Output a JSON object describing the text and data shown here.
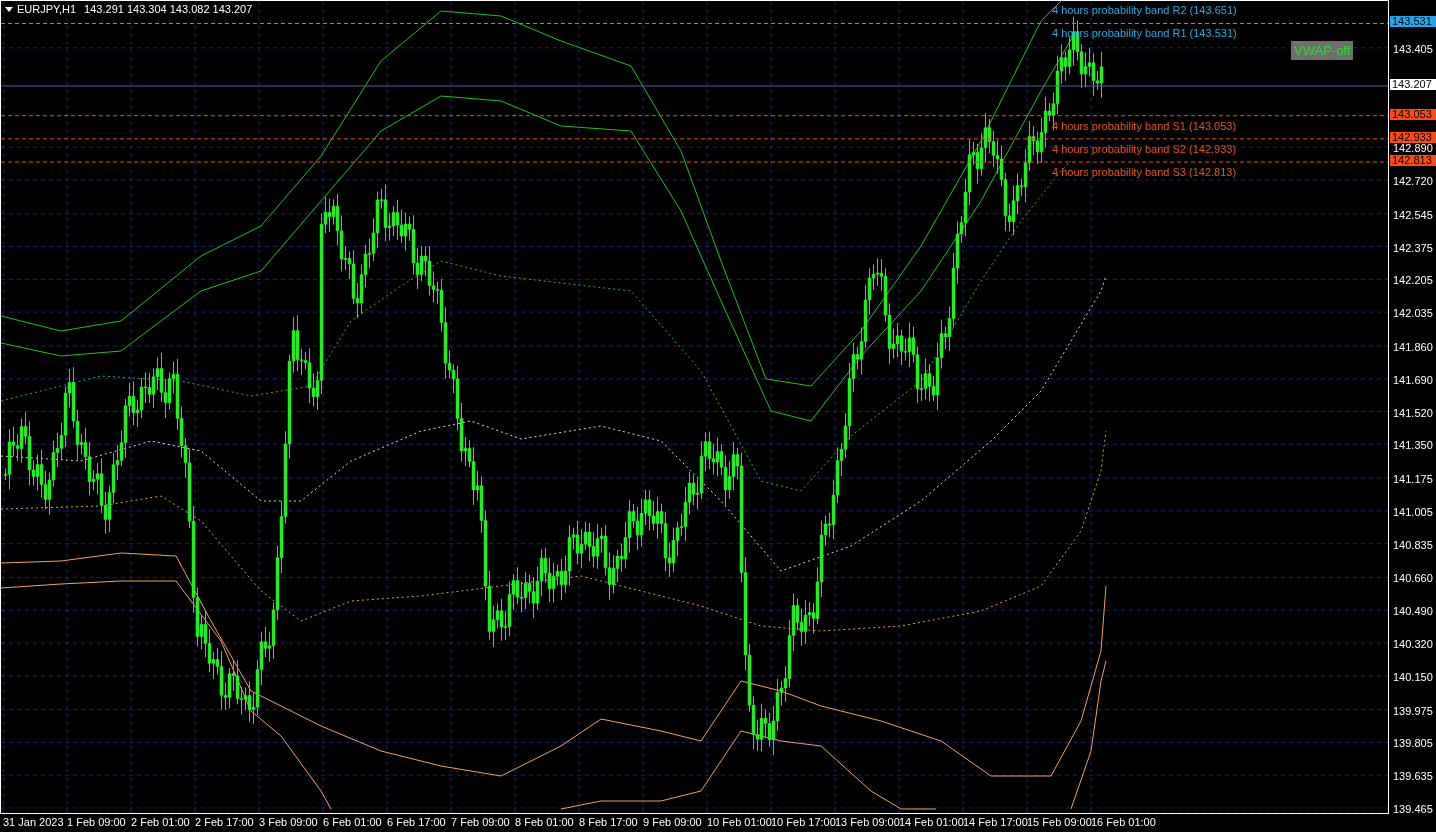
{
  "header": {
    "symbol": "EURJPY,H1",
    "ohlc": "143.291 143.304 143.082 143.207"
  },
  "vwap_button": {
    "label": "VWAP-off"
  },
  "bands": [
    {
      "label": "4 hours probability band R2 (143.651)",
      "kind": "resistance"
    },
    {
      "label": "4 hours probability band R1 (143.531)",
      "kind": "resistance"
    },
    {
      "label": "4 hours probability band S1 (143.053)",
      "kind": "support"
    },
    {
      "label": "4 hours probability band S2 (142.933)",
      "kind": "support"
    },
    {
      "label": "4 hours probability band S3 (142.813)",
      "kind": "support"
    }
  ],
  "price_axis": {
    "ticks": [
      "143.405",
      "142.890",
      "142.720",
      "142.545",
      "142.375",
      "142.205",
      "142.035",
      "141.860",
      "141.690",
      "141.520",
      "141.350",
      "141.175",
      "141.005",
      "140.835",
      "140.660",
      "140.490",
      "140.320",
      "140.150",
      "139.975",
      "139.805",
      "139.635",
      "139.465"
    ]
  },
  "price_tags": [
    {
      "text": "143.531",
      "kind": "resistance"
    },
    {
      "text": "143.207",
      "kind": "current"
    },
    {
      "text": "143.053",
      "kind": "support"
    },
    {
      "text": "142.933",
      "kind": "support"
    },
    {
      "text": "142.813",
      "kind": "support"
    }
  ],
  "time_axis": {
    "ticks": [
      "31 Jan 2023",
      "1 Feb 09:00",
      "2 Feb 01:00",
      "2 Feb 17:00",
      "3 Feb 09:00",
      "6 Feb 01:00",
      "6 Feb 17:00",
      "7 Feb 09:00",
      "8 Feb 01:00",
      "8 Feb 17:00",
      "9 Feb 09:00",
      "10 Feb 01:00",
      "10 Feb 17:00",
      "13 Feb 09:00",
      "14 Feb 01:00",
      "14 Feb 17:00",
      "15 Feb 09:00",
      "16 Feb 01:00"
    ]
  }
}
